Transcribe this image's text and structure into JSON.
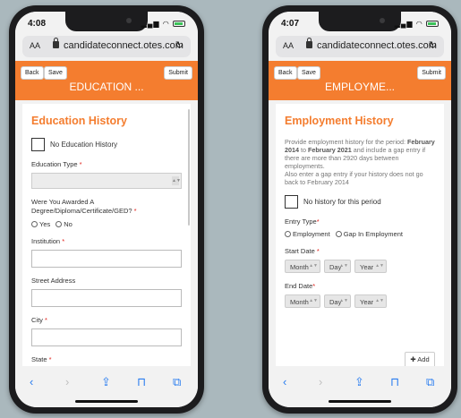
{
  "phone1": {
    "status": {
      "time": "4:08"
    },
    "url": {
      "aa": "AA",
      "host": "candidateconnect.otes.com"
    },
    "appbar": {
      "back": "Back",
      "save": "Save",
      "submit": "Submit",
      "title": "EDUCATION ..."
    },
    "form": {
      "heading": "Education History",
      "no_history": "No Education History",
      "education_type_label": "Education Type",
      "awarded_label": "Were You Awarded A Degree/Diploma/Certificate/GED?",
      "yes": "Yes",
      "no": "No",
      "institution_label": "Institution",
      "street_label": "Street Address",
      "city_label": "City",
      "state_label": "State",
      "required_mark": "*"
    }
  },
  "phone2": {
    "status": {
      "time": "4:07"
    },
    "url": {
      "aa": "AA",
      "host": "candidateconnect.otes.com"
    },
    "appbar": {
      "back": "Back",
      "save": "Save",
      "submit": "Submit",
      "title": "EMPLOYME..."
    },
    "form": {
      "heading": "Employment History",
      "desc_pre": "Provide employment history for the period: ",
      "desc_from": "February 2014",
      "desc_to_word": " to ",
      "desc_to": "February 2021",
      "desc_post": " and include a gap entry if there are more than 2920 days between employments.",
      "desc_line2": "Also enter a gap entry if your history does not go back to February 2014",
      "no_history": "No history for this period",
      "entry_type_label": "Entry Type",
      "employment": "Employment",
      "gap": "Gap In Employment",
      "start_label": "Start Date",
      "end_label": "End Date",
      "month": "Month",
      "day": "Day",
      "year": "Year",
      "add": "Add",
      "required_mark": "*"
    }
  },
  "toolbar": {
    "back_icon": "‹",
    "forward_icon": "›",
    "share_icon": "⇪",
    "bookmarks_icon": "⊓",
    "tabs_icon": "⧉"
  },
  "colors": {
    "accent": "#f47d2f",
    "required": "#e0211b",
    "link": "#2a7df0"
  }
}
